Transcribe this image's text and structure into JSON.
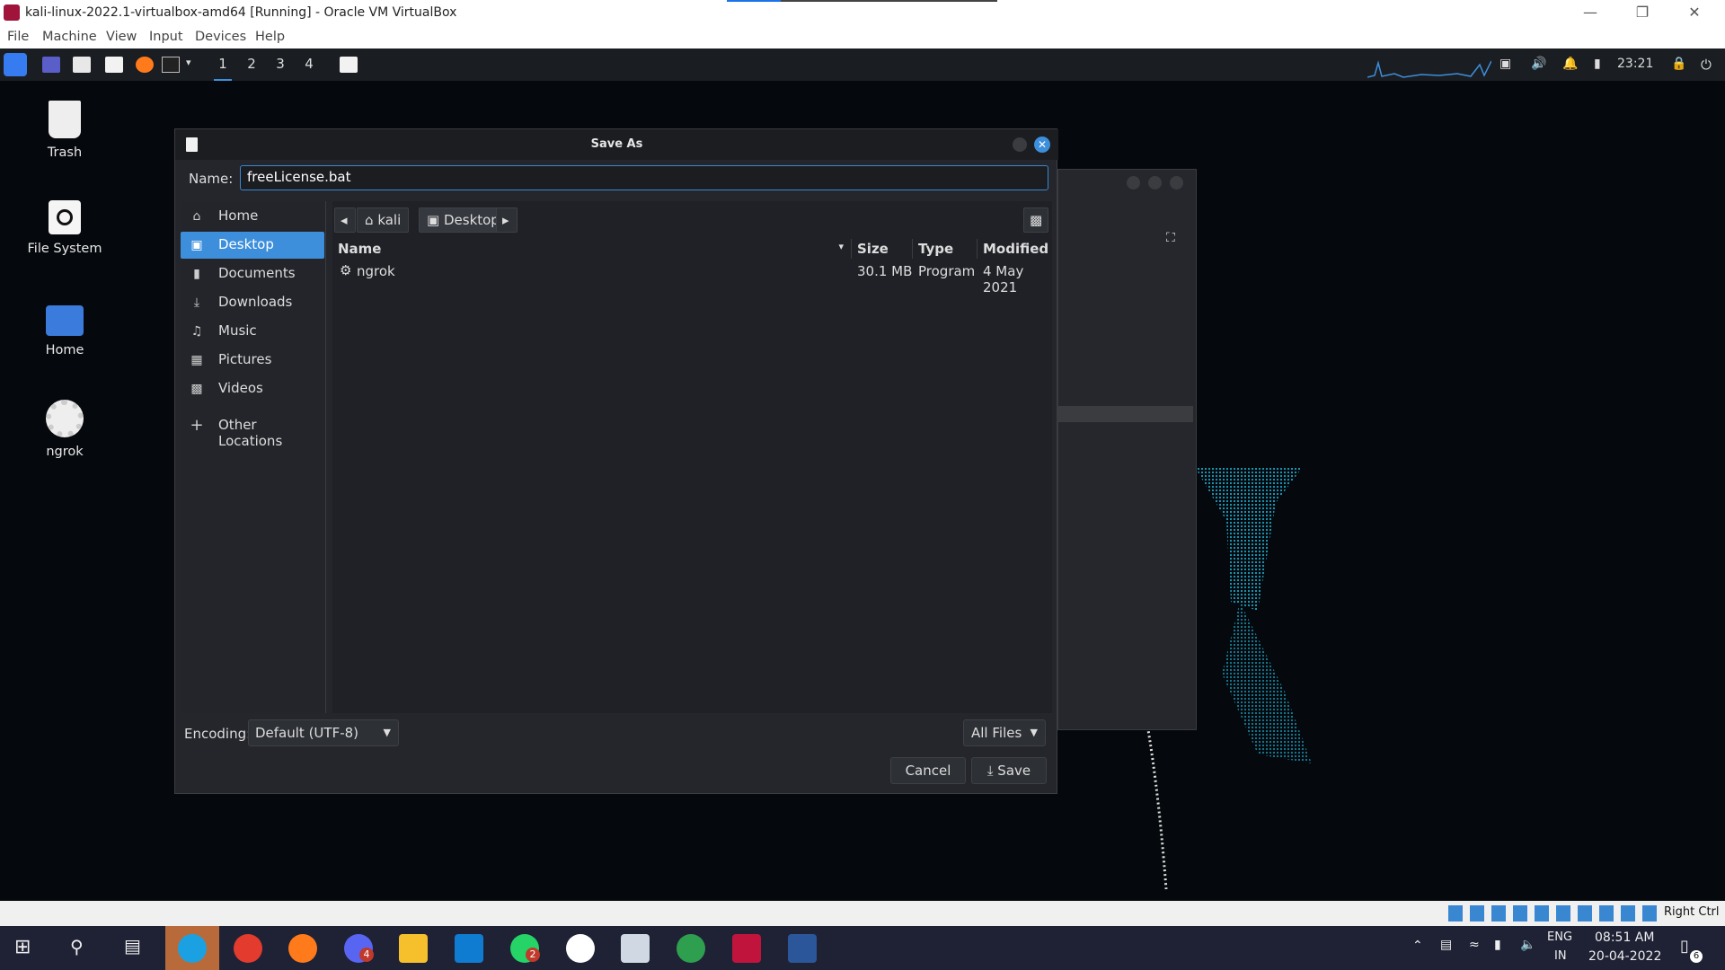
{
  "host": {
    "title": "kali-linux-2022.1-virtualbox-amd64 [Running] - Oracle VM VirtualBox",
    "menu": [
      "File",
      "Machine",
      "View",
      "Input",
      "Devices",
      "Help"
    ],
    "status_right": "Right Ctrl"
  },
  "kali_panel": {
    "workspaces": [
      "1",
      "2",
      "3",
      "4"
    ],
    "clock": "23:21"
  },
  "desktop_icons": [
    {
      "label": "Trash",
      "icon": "trash-icon"
    },
    {
      "label": "File System",
      "icon": "drive-icon"
    },
    {
      "label": "Home",
      "icon": "home-folder-icon"
    },
    {
      "label": "ngrok",
      "icon": "gear-icon"
    }
  ],
  "dialog": {
    "title": "Save As",
    "name_label": "Name:",
    "name_value": "freeLicense.bat",
    "sidebar": [
      {
        "label": "Home",
        "icon": "home-icon"
      },
      {
        "label": "Desktop",
        "icon": "desktop-icon",
        "selected": true
      },
      {
        "label": "Documents",
        "icon": "document-icon"
      },
      {
        "label": "Downloads",
        "icon": "download-icon"
      },
      {
        "label": "Music",
        "icon": "music-icon"
      },
      {
        "label": "Pictures",
        "icon": "picture-icon"
      },
      {
        "label": "Videos",
        "icon": "video-icon"
      },
      {
        "label": "Other Locations",
        "icon": "plus-icon"
      }
    ],
    "breadcrumb": [
      "kali",
      "Desktop"
    ],
    "columns": {
      "name": "Name",
      "size": "Size",
      "type": "Type",
      "modified": "Modified"
    },
    "files": [
      {
        "name": "ngrok",
        "size": "30.1 MB",
        "type": "Program",
        "modified": "4 May 2021"
      }
    ],
    "encoding_label": "Encoding:",
    "encoding_value": "Default (UTF-8)",
    "filter_value": "All Files",
    "cancel_label": "Cancel",
    "save_label": "Save"
  },
  "taskbar": {
    "lang": "ENG",
    "region": "IN",
    "time": "08:51 AM",
    "date": "20-04-2022",
    "notification_count": "6",
    "badge_discord": "4",
    "badge_whatsapp": "2"
  },
  "colors": {
    "accent": "#3d8fdc",
    "dialog_bg": "#24262b",
    "taskbar": "#1f2235"
  }
}
